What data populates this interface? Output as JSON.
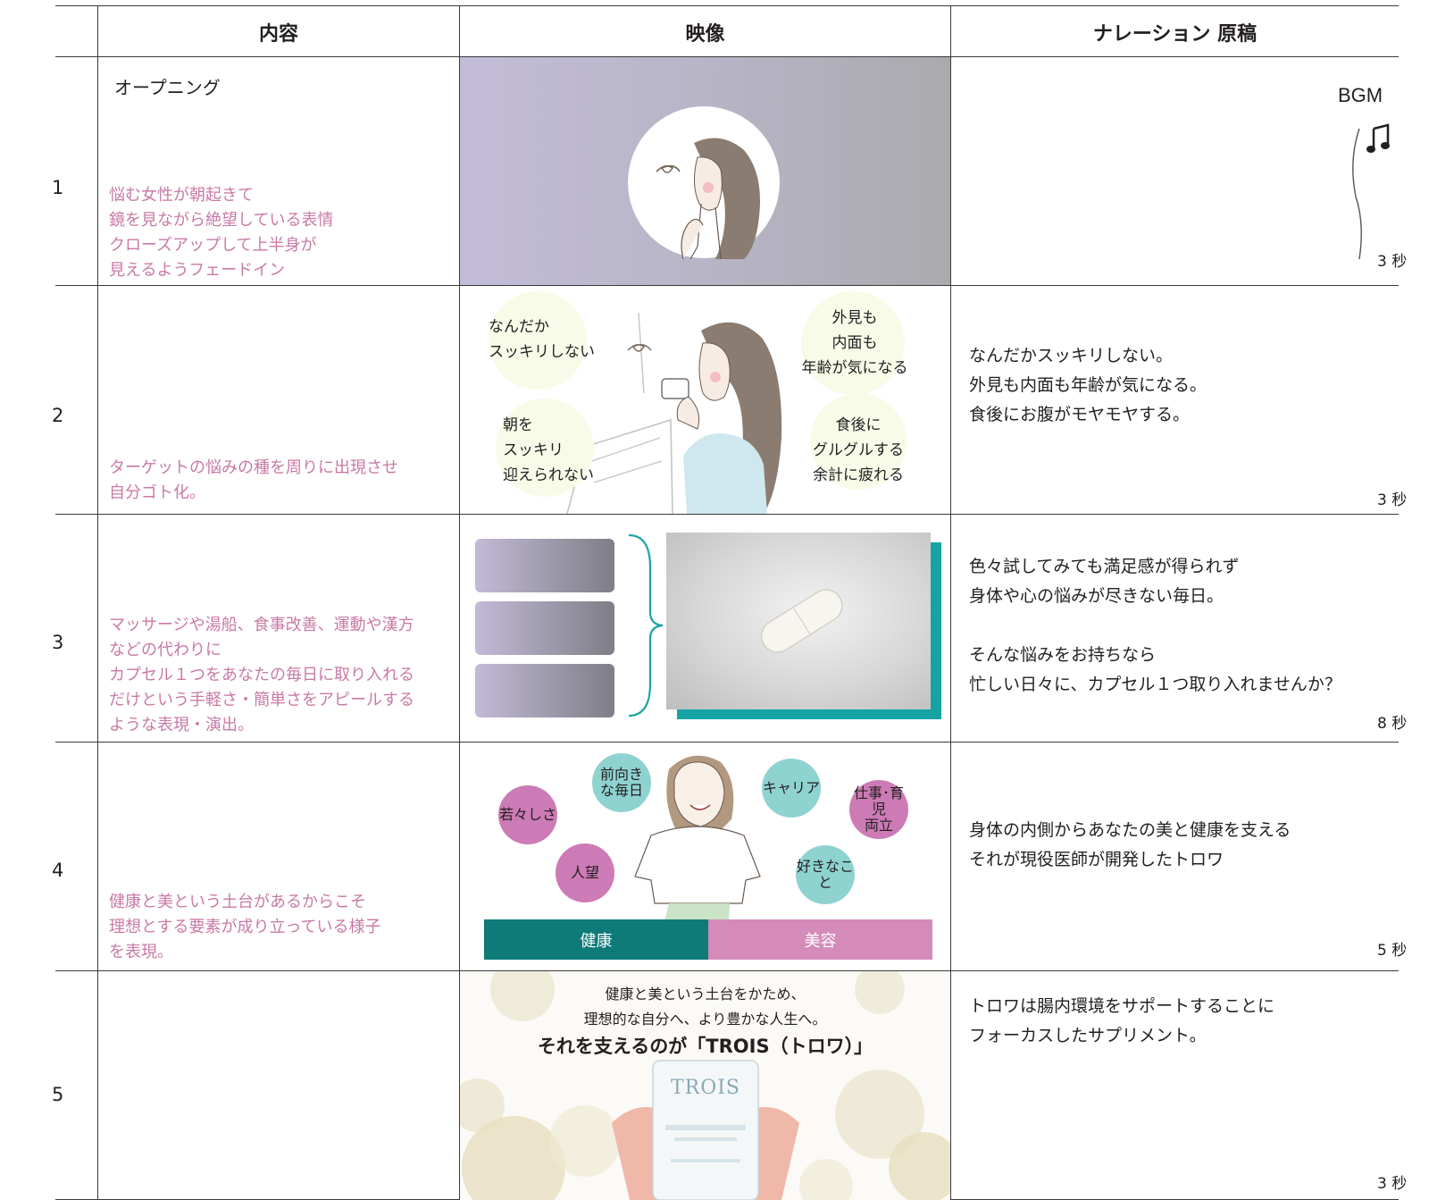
{
  "header": {
    "content": "内容",
    "video": "映像",
    "narration": "ナレーション 原稿"
  },
  "rows": [
    {
      "number": "1",
      "title": "オープニング",
      "description": [
        "悩む女性が朝起きて",
        "鏡を見ながら絶望している表情",
        "クローズアップして上半身が",
        "見えるようフェードイン"
      ],
      "narration": [],
      "bgm_label": "BGM",
      "duration": "3 秒"
    },
    {
      "number": "2",
      "description": [
        "ターゲットの悩みの種を周りに出現させ",
        "自分ゴト化。"
      ],
      "bubbles": [
        "なんだか\nスッキリしない",
        "外見も\n内面も\n年齢が気になる",
        "朝を\nスッキリ\n迎えられない",
        "食後に\nグルグルする\n余計に疲れる"
      ],
      "narration": [
        "なんだかスッキリしない。",
        "外見も内面も年齢が気になる。",
        "食後にお腹がモヤモヤする。"
      ],
      "duration": "3 秒"
    },
    {
      "number": "3",
      "description": [
        "マッサージや湯船、食事改善、運動や漢方",
        "などの代わりに",
        "カプセル１つをあなたの毎日に取り入れる",
        "だけという手軽さ・簡単さをアピールする",
        "ような表現・演出。"
      ],
      "narration": [
        "色々試してみても満足感が得られず",
        "身体や心の悩みが尽きない毎日。",
        "",
        "そんな悩みをお持ちなら",
        "忙しい日々に、カプセル１つ取り入れませんか？"
      ],
      "duration": "8 秒"
    },
    {
      "number": "4",
      "description": [
        "健康と美という土台があるからこそ",
        "理想とする要素が成り立っている様子",
        "を表現。"
      ],
      "tags": [
        "前向き\nな毎日",
        "キャリア",
        "若々しさ",
        "仕事･育児\n両立",
        "人望",
        "好きなこと"
      ],
      "base_labels": [
        "健康",
        "美容"
      ],
      "narration": [
        "身体の内側からあなたの美と健康を支える",
        "それが現役医師が開発したトロワ"
      ],
      "duration": "5 秒"
    },
    {
      "number": "5",
      "description": [],
      "video_text": [
        "健康と美という土台をかため、",
        "理想的な自分へ、より豊かな人生へ。",
        "それを支えるのが「TROIS（トロワ）」"
      ],
      "package_text": "TROIS",
      "narration": [
        "トロワは腸内環境をサポートすることに",
        "フォーカスしたサプリメント。"
      ],
      "duration": "3 秒"
    }
  ],
  "colors": {
    "description_pink": "#c97aa5",
    "teal": "#0f7b78",
    "pink": "#d48bb9",
    "light_teal": "#8fd3d1",
    "magenta": "#cc7bb6"
  }
}
